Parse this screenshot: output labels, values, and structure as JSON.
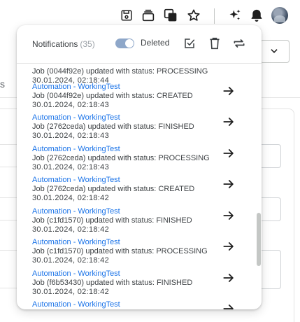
{
  "toolbar": {
    "icons": [
      "save-icon",
      "layers-icon",
      "copy-icon",
      "star-icon",
      "sparkle-icon",
      "bell-icon",
      "avatar"
    ]
  },
  "background": {
    "tab_fragment": "s"
  },
  "notifications": {
    "title": "Notifications",
    "count": "(35)",
    "toggle_label": "Deleted",
    "toggle_on": true,
    "items": [
      {
        "source": "",
        "message": "Job (0044f92e) updated with status: PROCESSING",
        "time": "30.01.2024, 02:18:44"
      },
      {
        "source": "Automation - WorkingTest",
        "message": "Job (0044f92e) updated with status: CREATED",
        "time": "30.01.2024, 02:18:43"
      },
      {
        "source": "Automation - WorkingTest",
        "message": "Job (2762ceda) updated with status: FINISHED",
        "time": "30.01.2024, 02:18:43"
      },
      {
        "source": "Automation - WorkingTest",
        "message": "Job (2762ceda) updated with status: PROCESSING",
        "time": "30.01.2024, 02:18:43"
      },
      {
        "source": "Automation - WorkingTest",
        "message": "Job (2762ceda) updated with status: CREATED",
        "time": "30.01.2024, 02:18:42"
      },
      {
        "source": "Automation - WorkingTest",
        "message": "Job (c1fd1570) updated with status: FINISHED",
        "time": "30.01.2024, 02:18:42"
      },
      {
        "source": "Automation - WorkingTest",
        "message": "Job (c1fd1570) updated with status: PROCESSING",
        "time": "30.01.2024, 02:18:42"
      },
      {
        "source": "Automation - WorkingTest",
        "message": "Job (f6b53430) updated with status: FINISHED",
        "time": "30.01.2024, 02:18:42"
      },
      {
        "source": "Automation - WorkingTest",
        "message": "",
        "time": ""
      }
    ]
  },
  "colors": {
    "link": "#1a73e8",
    "toggle_track": "#8ea7c9",
    "text": "#3c4043",
    "count": "#9aa0a6"
  }
}
